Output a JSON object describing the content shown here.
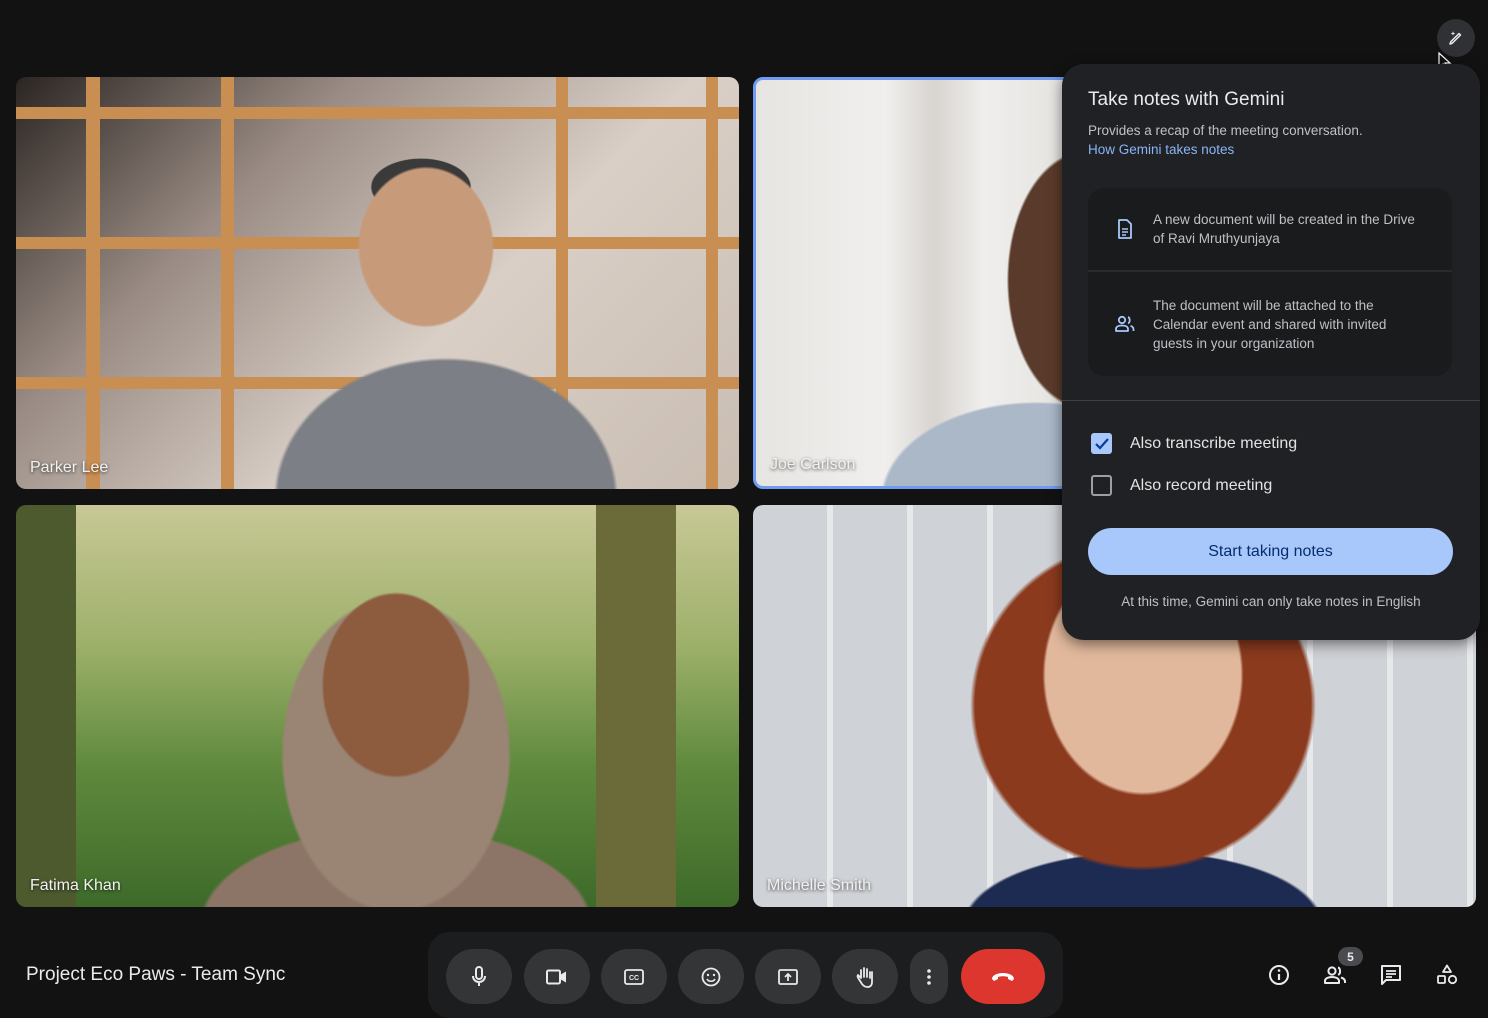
{
  "participants": [
    {
      "name": "Parker Lee",
      "active_speaker": false
    },
    {
      "name": "Joe Carlson",
      "active_speaker": true
    },
    {
      "name": "Fatima Khan",
      "active_speaker": false
    },
    {
      "name": "Michelle Smith",
      "active_speaker": false
    }
  ],
  "top_button": {
    "icon": "gemini-pen-sparkle-icon"
  },
  "gemini_panel": {
    "title": "Take notes with Gemini",
    "description": "Provides a recap of the meeting conversation.",
    "link": "How Gemini takes notes",
    "info": [
      {
        "icon": "document-icon",
        "text": "A new document will be created in the Drive of Ravi Mruthyunjaya"
      },
      {
        "icon": "people-icon",
        "text": "The document will be attached to the Calendar event and shared with invited guests in your organization"
      }
    ],
    "options": [
      {
        "label": "Also transcribe meeting",
        "checked": true
      },
      {
        "label": "Also record meeting",
        "checked": false
      }
    ],
    "start_button": "Start taking notes",
    "footnote": "At this time, Gemini can only take notes in English"
  },
  "bottom_bar": {
    "meeting_title": "Project Eco Paws - Team Sync",
    "controls": [
      {
        "name": "microphone",
        "icon": "mic-icon"
      },
      {
        "name": "camera",
        "icon": "camera-icon"
      },
      {
        "name": "captions",
        "icon": "captions-icon"
      },
      {
        "name": "reactions",
        "icon": "emoji-icon"
      },
      {
        "name": "present",
        "icon": "present-screen-icon"
      },
      {
        "name": "raise-hand",
        "icon": "hand-icon"
      },
      {
        "name": "more-options",
        "icon": "more-vertical-icon"
      },
      {
        "name": "leave-call",
        "icon": "hang-up-icon"
      }
    ],
    "side": {
      "info": "info-icon",
      "people": "people-icon",
      "people_count": "5",
      "chat": "chat-icon",
      "activities": "activities-icon"
    }
  },
  "colors": {
    "accent": "#a8c7fa",
    "link": "#8ab4f8",
    "leave": "#dc362e",
    "active_speaker_border": "#6f9cf0"
  }
}
